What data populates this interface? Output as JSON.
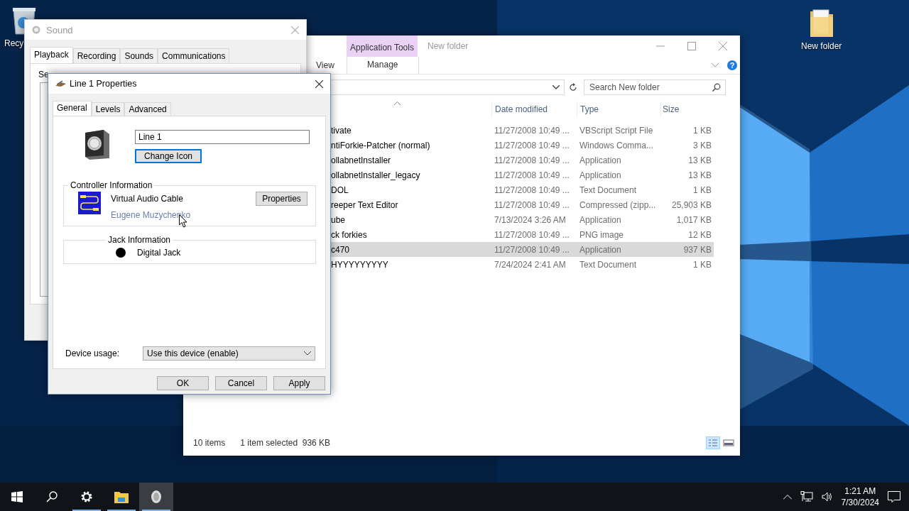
{
  "desktop_icons": [
    {
      "kind": "recycle",
      "label": "Recy"
    },
    {
      "kind": "folder",
      "label": "New folder"
    }
  ],
  "sound_window": {
    "title": "Sound",
    "tabs": [
      {
        "label": "Playback",
        "selected": true
      },
      {
        "label": "Recording",
        "selected": false
      },
      {
        "label": "Sounds",
        "selected": false
      },
      {
        "label": "Communications",
        "selected": false
      }
    ],
    "instruction": "Se"
  },
  "explorer": {
    "title": "New folder",
    "context_group": "Application Tools",
    "ribbon_tabs": [
      {
        "label": "View",
        "selected": false
      },
      {
        "label": "Manage",
        "selected": false
      }
    ],
    "help": "?",
    "search": {
      "placeholder": "Search New folder"
    },
    "columns": [
      "Date modified",
      "Type",
      "Size"
    ],
    "rows": [
      {
        "name": "tivate",
        "date": "11/27/2008 10:49 ...",
        "type": "VBScript Script File",
        "size": "1 KB",
        "selected": false
      },
      {
        "name": "ntiForkie-Patcher (normal)",
        "date": "11/27/2008 10:49 ...",
        "type": "Windows Comma...",
        "size": "3 KB",
        "selected": false
      },
      {
        "name": "ollabnetInstaller",
        "date": "11/27/2008 10:49 ...",
        "type": "Application",
        "size": "13 KB",
        "selected": false
      },
      {
        "name": "ollabnetInstaller_legacy",
        "date": "11/27/2008 10:49 ...",
        "type": "Application",
        "size": "13 KB",
        "selected": false
      },
      {
        "name": "DOL",
        "date": "11/27/2008 10:49 ...",
        "type": "Text Document",
        "size": "1 KB",
        "selected": false
      },
      {
        "name": "reeper Text Editor",
        "date": "11/27/2008 10:49 ...",
        "type": "Compressed (zipp...",
        "size": "25,903 KB",
        "selected": false
      },
      {
        "name": "ube",
        "date": "7/13/2024 3:26 AM",
        "type": "Application",
        "size": "1,017 KB",
        "selected": false
      },
      {
        "name": "ck forkies",
        "date": "11/27/2008 10:49 ...",
        "type": "PNG image",
        "size": "12 KB",
        "selected": false
      },
      {
        "name": "c470",
        "date": "11/27/2008 10:49 ...",
        "type": "Application",
        "size": "937 KB",
        "selected": true
      },
      {
        "name": "HYYYYYYYYY",
        "date": "7/24/2024 2:41 AM",
        "type": "Text Document",
        "size": "1 KB",
        "selected": false
      }
    ],
    "status": {
      "count": "10 items",
      "selection": "1 item selected  936 KB"
    },
    "views": [
      {
        "kind": "details",
        "selected": true
      },
      {
        "kind": "tiles",
        "selected": false
      }
    ]
  },
  "dialog": {
    "title": "Line 1 Properties",
    "tabs": [
      {
        "label": "General",
        "selected": true
      },
      {
        "label": "Levels",
        "selected": false
      },
      {
        "label": "Advanced",
        "selected": false
      }
    ],
    "name_value": "Line 1",
    "change_icon": "Change Icon",
    "controller": {
      "legend": "Controller Information",
      "name": "Virtual Audio Cable",
      "vendor": "Eugene Muzychenko",
      "button": "Properties"
    },
    "jack": {
      "legend": "Jack Information",
      "name": "Digital Jack",
      "color": "#000000"
    },
    "usage": {
      "label": "Device usage:",
      "value": "Use this device (enable)"
    },
    "buttons": [
      "OK",
      "Cancel",
      "Apply"
    ]
  },
  "taskbar": {
    "apps": [
      {
        "kind": "start",
        "active": false,
        "running": false
      },
      {
        "kind": "search",
        "active": false,
        "running": false
      },
      {
        "kind": "settings",
        "active": false,
        "running": true
      },
      {
        "kind": "explorer",
        "active": false,
        "running": true
      },
      {
        "kind": "sound",
        "active": true,
        "running": true
      }
    ],
    "time": "1:21 AM",
    "date": "7/30/2024"
  }
}
